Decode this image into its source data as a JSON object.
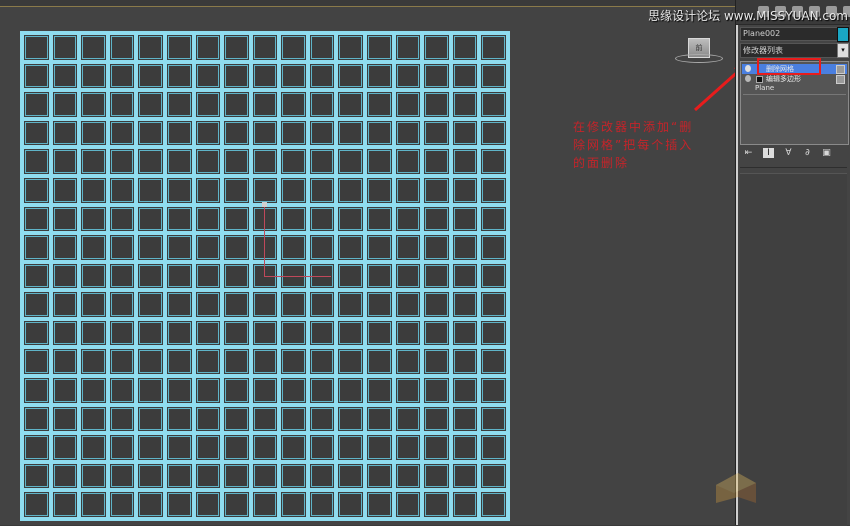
{
  "viewport": {
    "label": "",
    "grid_cells": 289
  },
  "viewcube": {
    "label": "前"
  },
  "annotation": {
    "text": "在修改器中添加“删除网格”把每个插入的面删除"
  },
  "watermark": {
    "text": "思缘设计论坛 www.MISSYUAN.com"
  },
  "panel": {
    "object_name": "Plane002",
    "color": "#1aa7c4",
    "modifier_list_label": "修改器列表",
    "modifier_list_arrow": "▾",
    "stack": [
      {
        "label": "删除网格",
        "selected": true
      },
      {
        "label": "编辑多边形",
        "selected": false
      }
    ],
    "base_object": "Plane",
    "toolbar": [
      "⇤",
      "I",
      "∀",
      "∂",
      "▣"
    ]
  },
  "colors": {
    "wire": "#8fdcef",
    "accent_red": "#e81c1c",
    "annotation_red": "#c4242a"
  }
}
